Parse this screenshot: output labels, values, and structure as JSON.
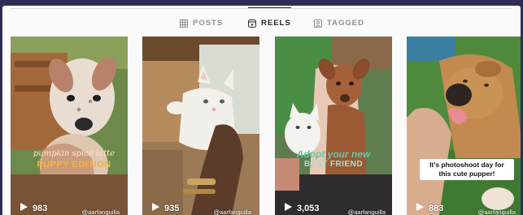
{
  "tabs": [
    {
      "label": "POSTS",
      "icon": "grid-icon",
      "active": false
    },
    {
      "label": "REELS",
      "icon": "reels-icon",
      "active": true
    },
    {
      "label": "TAGGED",
      "icon": "tagged-icon",
      "active": false
    }
  ],
  "reels": [
    {
      "views": "983",
      "caption_line1": "pumpkin spice latte",
      "caption_line2": "PUPPY EDITION",
      "watermark": "@aarfanguilla"
    },
    {
      "views": "935",
      "watermark": "@aarfanguilla"
    },
    {
      "views": "3,053",
      "caption_line1": "Adopt your new",
      "caption_line2": "BEST FRIEND",
      "watermark": "@aarfanguilla"
    },
    {
      "views": "883",
      "caption_line1": "It's photoshoot day for this cute pupper!",
      "watermark": "@aarfanguilla"
    }
  ],
  "colors": {
    "accent": "#262626",
    "muted": "#8e8e8e",
    "background": "#fafafa",
    "outer": "#2e2e55"
  }
}
